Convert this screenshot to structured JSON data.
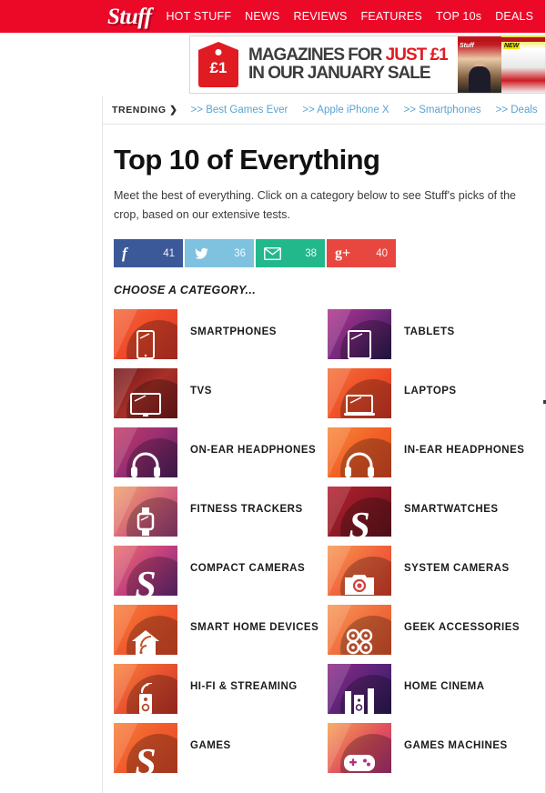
{
  "header": {
    "logo": "Stuff",
    "brand_color": "#ec0928",
    "nav": [
      {
        "label": "HOT STUFF",
        "name": "nav-hot-stuff"
      },
      {
        "label": "NEWS",
        "name": "nav-news"
      },
      {
        "label": "REVIEWS",
        "name": "nav-reviews"
      },
      {
        "label": "FEATURES",
        "name": "nav-features"
      },
      {
        "label": "TOP 10s",
        "name": "nav-top-10s"
      },
      {
        "label": "DEALS",
        "name": "nav-deals"
      }
    ]
  },
  "ad": {
    "tag_price": "£1",
    "line1_a": "MAGAZINES FOR ",
    "line1_b": "JUST £1",
    "line2": "IN OUR JANUARY SALE",
    "cover1_text": "Stuff",
    "cover2_text": "NEW"
  },
  "trending": {
    "label": "TRENDING ❯",
    "links": [
      {
        "label": ">> Best Games Ever",
        "name": "trending-best-games-ever"
      },
      {
        "label": ">> Apple iPhone X",
        "name": "trending-apple-iphone-x"
      },
      {
        "label": ">> Smartphones",
        "name": "trending-smartphones"
      },
      {
        "label": ">> Deals",
        "name": "trending-deals"
      }
    ],
    "link_color": "#5aa3cf"
  },
  "main": {
    "title": "Top 10 of Everything",
    "description": "Meet the best of everything. Click on a category below to see Stuff's picks of the crop, based on our extensive tests.",
    "choose_heading": "CHOOSE A CATEGORY..."
  },
  "share": [
    {
      "network": "facebook",
      "icon": "facebook-icon",
      "glyph": "f",
      "count": "41",
      "color": "#3b5998"
    },
    {
      "network": "twitter",
      "icon": "twitter-icon",
      "glyph": "",
      "count": "36",
      "color": "#7ec2e0"
    },
    {
      "network": "email",
      "icon": "email-icon",
      "glyph": "",
      "count": "38",
      "color": "#22b88c"
    },
    {
      "network": "googleplus",
      "icon": "google-plus-icon",
      "glyph": "g+",
      "count": "40",
      "color": "#e8473f"
    }
  ],
  "categories": [
    {
      "label": "SMARTPHONES",
      "icon": "smartphone-icon",
      "name": "category-smartphones",
      "gradient": "linear-gradient(135deg,#f4683a 0%,#ef4b2a 45%,#d8372a 100%)"
    },
    {
      "label": "TABLETS",
      "icon": "tablet-icon",
      "name": "category-tablets",
      "gradient": "linear-gradient(135deg,#b2338c 0%,#7a2a7e 45%,#2a1a52 100%)"
    },
    {
      "label": "TVS",
      "icon": "tv-icon",
      "name": "category-tvs",
      "gradient": "linear-gradient(135deg,#6e1418 0%,#a83028 50%,#7e1a1c 100%)"
    },
    {
      "label": "LAPTOPS",
      "icon": "laptop-icon",
      "name": "category-laptops",
      "gradient": "linear-gradient(135deg,#f4713a 0%,#ef4f28 50%,#d8382a 100%)"
    },
    {
      "label": "ON-EAR HEADPHONES",
      "icon": "headphones-icon",
      "name": "category-on-ear-headphones",
      "gradient": "linear-gradient(135deg,#c23a62 0%,#9b2f72 45%,#4e1f63 100%)"
    },
    {
      "label": "IN-EAR HEADPHONES",
      "icon": "headphones-icon",
      "name": "category-in-ear-headphones",
      "gradient": "linear-gradient(135deg,#f78a3c 0%,#f26026 50%,#e04a28 100%)"
    },
    {
      "label": "FITNESS TRACKERS",
      "icon": "fitness-tracker-icon",
      "name": "category-fitness-trackers",
      "gradient": "linear-gradient(135deg,#f0a06a 0%,#d4627a 55%,#9c3f7e 100%)"
    },
    {
      "label": "SMARTWATCHES",
      "icon": "stuff-s-icon",
      "name": "category-smartwatches",
      "gradient": "linear-gradient(135deg,#b2202c 0%,#8e1a26 50%,#6a1420 100%)"
    },
    {
      "label": "COMPACT CAMERAS",
      "icon": "stuff-s-icon",
      "name": "category-compact-cameras",
      "gradient": "linear-gradient(135deg,#e8706a 0%,#c2407e 50%,#6a2a7e 100%)"
    },
    {
      "label": "SYSTEM CAMERAS",
      "icon": "camera-icon",
      "name": "category-system-cameras",
      "gradient": "linear-gradient(135deg,#f79a52 0%,#f0603a 55%,#e0402c 100%)"
    },
    {
      "label": "SMART HOME DEVICES",
      "icon": "smart-home-icon",
      "name": "category-smart-home-devices",
      "gradient": "linear-gradient(135deg,#f7803a 0%,#f05a2c 50%,#e24a2a 100%)"
    },
    {
      "label": "GEEK ACCESSORIES",
      "icon": "gears-icon",
      "name": "category-geek-accessories",
      "gradient": "linear-gradient(135deg,#f79a5a 0%,#ef6a3a 55%,#e2522e 100%)"
    },
    {
      "label": "HI-FI & STREAMING",
      "icon": "speaker-wifi-icon",
      "name": "category-hi-fi-streaming",
      "gradient": "linear-gradient(135deg,#f7843c 0%,#ea5430 48%,#c93328 100%)"
    },
    {
      "label": "HOME CINEMA",
      "icon": "home-cinema-icon",
      "name": "category-home-cinema",
      "gradient": "linear-gradient(135deg,#8e2a86 0%,#5a2478 50%,#2a1a56 100%)"
    },
    {
      "label": "GAMES",
      "icon": "stuff-s-icon",
      "name": "category-games",
      "gradient": "linear-gradient(135deg,#f7803a 0%,#f05a2c 50%,#e04a2a 100%)"
    },
    {
      "label": "GAMES MACHINES",
      "icon": "gamepad-icon",
      "name": "category-games-machines",
      "gradient": "linear-gradient(135deg,#f7a050 0%,#e0505e 55%,#b2327e 100%)"
    }
  ]
}
